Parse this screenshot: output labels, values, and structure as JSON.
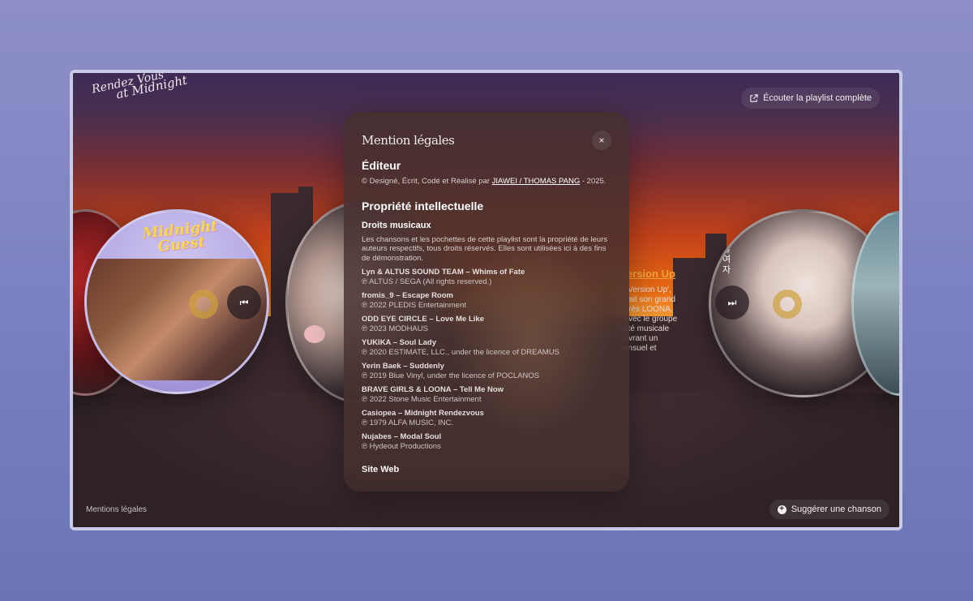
{
  "app": {
    "logo_line1": "Rendez Vous",
    "logo_line2": "at Midnight",
    "listen_button": "Écouter la playlist complète",
    "footer_link": "Mentions légales",
    "suggest_button": "Suggérer une chanson"
  },
  "background_song": {
    "title": "Version Up",
    "lines": [
      "n 'Version Up',",
      "e fait son grand",
      "après LOONA,",
      "t avec le groupe",
      "ntité musicale",
      "ouvrant un",
      "sensuel et"
    ]
  },
  "album_art": {
    "midnight_guest": "Midnight Guest",
    "korean_text": "술여자"
  },
  "modal": {
    "title": "Mention légales",
    "editor_heading": "Éditeur",
    "editor_text_prefix": "© Designé, Écrit, Codé et Réalisé par",
    "editor_link": "JIAWEI / THOMAS PANG",
    "editor_text_suffix": "- 2025.",
    "ip_heading": "Propriété intellectuelle",
    "music_rights_heading": "Droits musicaux",
    "music_rights_text": "Les chansons et les pochettes de cette playlist sont la propriété de leurs auteurs respectifs, tous droits réservés. Elles sont utilisées ici à des fins de démonstration.",
    "credits": [
      {
        "title": "Lyn & ALTUS SOUND TEAM – Whims of Fate",
        "line": "℗ ALTUS / SEGA (All rights reserved.)"
      },
      {
        "title": "fromis_9 – Escape Room",
        "line": "℗ 2022 PLEDIS Entertainment"
      },
      {
        "title": "ODD EYE CIRCLE – Love Me Like",
        "line": "℗ 2023 MODHAUS"
      },
      {
        "title": "YUKIKA – Soul Lady",
        "line": "℗ 2020 ESTIMATE, LLC., under the licence of DREAMUS"
      },
      {
        "title": "Yerin Baek – Suddenly",
        "line": "℗ 2019 Blue Vinyl, under the licence of POCLANOS"
      },
      {
        "title": "BRAVE GIRLS & LOONA – Tell Me Now",
        "line": "℗ 2022 Stone Music Entertainment"
      },
      {
        "title": "Casiopea – Midnight Rendezvous",
        "line": "℗ 1979 ALFA MUSIC, INC."
      },
      {
        "title": "Nujabes – Modal Soul",
        "line": "℗ Hydeout Productions"
      }
    ],
    "website_heading": "Site Web",
    "close_symbol": "×"
  },
  "colors": {
    "accent": "#f3a43b",
    "modal_bg": "#46302e",
    "page_bg": "#7d82c2"
  }
}
